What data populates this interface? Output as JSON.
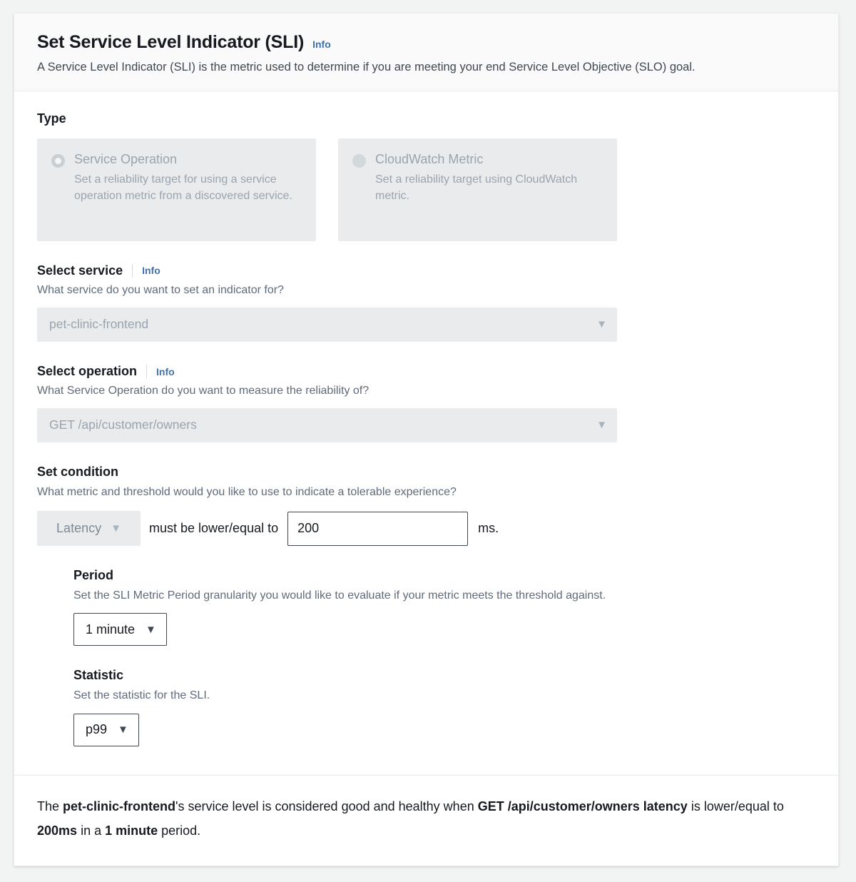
{
  "header": {
    "title": "Set Service Level Indicator (SLI)",
    "info_label": "Info",
    "description": "A Service Level Indicator (SLI) is the metric used to determine if you are meeting your end Service Level Objective (SLO) goal."
  },
  "type_section": {
    "label": "Type",
    "options": [
      {
        "title": "Service Operation",
        "description": "Set a reliability target for using a service operation metric from a discovered service.",
        "selected": true,
        "radio_icon": "radio-selected-icon"
      },
      {
        "title": "CloudWatch Metric",
        "description": "Set a reliability target using CloudWatch metric.",
        "selected": false,
        "radio_icon": "radio-unselected-icon"
      }
    ]
  },
  "select_service": {
    "label": "Select service",
    "info_label": "Info",
    "description": "What service do you want to set an indicator for?",
    "value": "pet-clinic-frontend",
    "caret_icon": "chevron-down-icon"
  },
  "select_operation": {
    "label": "Select operation",
    "info_label": "Info",
    "description": "What Service Operation do you want to measure the reliability of?",
    "value": "GET /api/customer/owners",
    "caret_icon": "chevron-down-icon"
  },
  "set_condition": {
    "label": "Set condition",
    "description": "What metric and threshold would you like to use to indicate a tolerable experience?",
    "metric_value": "Latency",
    "comparison_text": "must be lower/equal to",
    "threshold_value": "200",
    "threshold_placeholder": "200",
    "unit_label": "ms.",
    "caret_icon": "chevron-down-icon"
  },
  "period": {
    "label": "Period",
    "description": "Set the SLI Metric Period granularity you would like to evaluate if your metric meets the threshold against.",
    "value": "1 minute",
    "caret_icon": "chevron-down-icon"
  },
  "statistic": {
    "label": "Statistic",
    "description": "Set the statistic for the SLI.",
    "value": "p99",
    "caret_icon": "chevron-down-icon"
  },
  "summary": {
    "part1": "The ",
    "service": "pet-clinic-frontend",
    "part2": "'s service level is considered good and healthy when ",
    "operation": "GET /api/customer/owners latency",
    "part3": " is lower/equal to ",
    "threshold": "200ms",
    "part4": " in a ",
    "period": "1 minute",
    "part5": " period."
  },
  "colors": {
    "link": "#3f72ac",
    "text": "#16191f",
    "muted": "#5f6b7a",
    "disabled_text": "#9aa4ad",
    "disabled_bg": "#e9ebed",
    "header_bg": "#fafafa",
    "page_bg": "#f2f3f3"
  }
}
